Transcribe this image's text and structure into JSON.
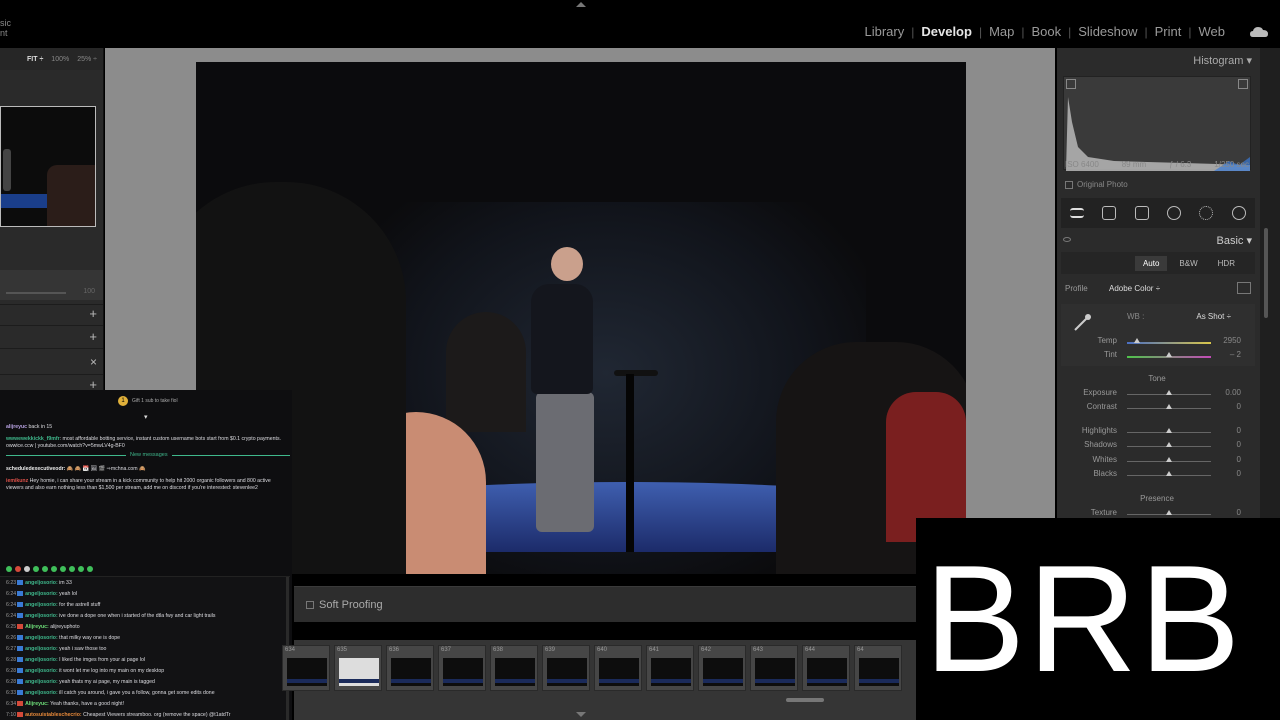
{
  "app": {
    "brand_line1": "sic",
    "brand_line2": "nt"
  },
  "modules": [
    "Library",
    "Develop",
    "Map",
    "Book",
    "Slideshow",
    "Print",
    "Web"
  ],
  "active_module": "Develop",
  "navigator": {
    "fit": "FIT ÷",
    "zoom1": "100%",
    "zoom2": "25% ÷",
    "slider_value": "100"
  },
  "right_panel": {
    "histogram_title": "Histogram",
    "exif": {
      "iso": "ISO 6400",
      "focal": "89 mm",
      "aperture": "ƒ / 6.3",
      "shutter": "1/250 sec"
    },
    "original_photo": "Original Photo",
    "basic_title": "Basic",
    "treatment": {
      "auto": "Auto",
      "bw": "B&W",
      "hdr": "HDR"
    },
    "profile_label": "Profile",
    "profile_value": "Adobe Color ÷",
    "wb_label": "WB :",
    "wb_value": "As Shot ÷",
    "temp": {
      "label": "Temp",
      "value": "2950"
    },
    "tint": {
      "label": "Tint",
      "value": "– 2"
    },
    "tone_label": "Tone",
    "exposure": {
      "label": "Exposure",
      "value": "0.00"
    },
    "contrast": {
      "label": "Contrast",
      "value": "0"
    },
    "highlights": {
      "label": "Highlights",
      "value": "0"
    },
    "shadows": {
      "label": "Shadows",
      "value": "0"
    },
    "whites": {
      "label": "Whites",
      "value": "0"
    },
    "blacks": {
      "label": "Blacks",
      "value": "0"
    },
    "presence_label": "Presence",
    "texture": {
      "label": "Texture",
      "value": "0"
    }
  },
  "soft_proofing": "Soft Proofing",
  "filmstrip": [
    "634",
    "635",
    "636",
    "637",
    "638",
    "639",
    "640",
    "641",
    "642",
    "643",
    "644",
    "64"
  ],
  "brb": "BRB",
  "chat": {
    "gift_text": "Gift 1 sub to take fiol",
    "msg1_user": "alijreyuc",
    "msg1_text": "back in 15",
    "msg2_user": "wwwewekkickk_f9mfr",
    "msg2_text": "most affordable botting service, instant custom username bots start from $0.1 crypto payments. owwice.ccw | youtube.com/watch?v=5mwLV4g-BF0",
    "new_messages": "New messages",
    "msg3_user": "scheduledexecutiveodr:",
    "msg3_text": "🙈 🙈 📆 🖼 🎬 ⇒mchna.com 🙈",
    "msg4_user": "iemikunz",
    "msg4_text": "Hey homie, i can share your stream in a kick community to help hit 2000 organic followers and 800 active viewers and also earn nothing less than $1,500 per stream, add me on discord if you're interested: stevenlee2",
    "log": [
      {
        "time": "6:23",
        "user": "angeljosorio:",
        "text": "im 33"
      },
      {
        "time": "6:24",
        "user": "angeljosorio:",
        "text": "yeah lol"
      },
      {
        "time": "6:24",
        "user": "angeljosorio:",
        "text": "for the astrell stuff"
      },
      {
        "time": "6:24",
        "user": "angeljosorio:",
        "text": "ive done a dope one when i started of the dtla fwy and car light trails"
      },
      {
        "time": "6:25",
        "user": "Alijreyuc:",
        "text": "alijreyuphoto"
      },
      {
        "time": "6:26",
        "user": "angeljosorio:",
        "text": "that milky way one is dope"
      },
      {
        "time": "6:27",
        "user": "angeljosorio:",
        "text": "yeah i saw those too"
      },
      {
        "time": "6:28",
        "user": "angeljosorio:",
        "text": "I liked the imges from your ai page lol"
      },
      {
        "time": "6:28",
        "user": "angeljosorio:",
        "text": "it wont let me log into my main on my desktop"
      },
      {
        "time": "6:28",
        "user": "angeljosorio:",
        "text": "yeah thats my ai page, my main is tagged"
      },
      {
        "time": "6:33",
        "user": "angeljosorio:",
        "text": "ill catch you around, i gave you a follow, gonna get some edits done"
      },
      {
        "time": "6:34",
        "user": "Alijreyuc:",
        "text": "Yeah thanks, have a good night!"
      },
      {
        "time": "7:10",
        "user": "autosuistableschecrio:",
        "text": "Cheapest Viewers streamboo. org (remove the space) @t1atdTr"
      }
    ]
  }
}
